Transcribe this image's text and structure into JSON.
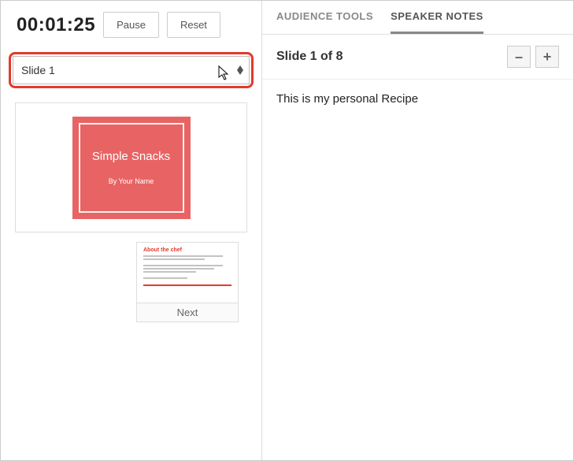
{
  "timer": {
    "elapsed": "00:01:25",
    "pause_label": "Pause",
    "reset_label": "Reset"
  },
  "slide_selector": {
    "selected": "Slide 1"
  },
  "current_slide": {
    "title": "Simple Snacks",
    "byline": "By Your Name"
  },
  "next_slide": {
    "thumb_title": "About the chef",
    "label": "Next"
  },
  "tabs": {
    "audience": "AUDIENCE TOOLS",
    "speaker": "SPEAKER NOTES"
  },
  "notes": {
    "header": "Slide 1 of 8",
    "body": "This is my personal Recipe",
    "zoom_out": "–",
    "zoom_in": "+"
  }
}
